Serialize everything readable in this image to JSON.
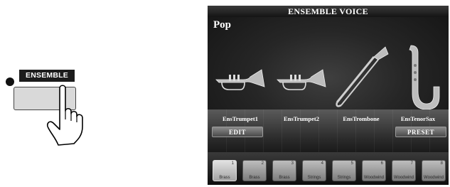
{
  "panel": {
    "button_label": "ENSEMBLE"
  },
  "screen": {
    "title": "ENSEMBLE VOICE",
    "category": "Pop",
    "instruments": [
      {
        "name": "EnsTrumpet1",
        "icon": "trumpet-icon"
      },
      {
        "name": "EnsTrumpet2",
        "icon": "trumpet-icon"
      },
      {
        "name": "EnsTrombone",
        "icon": "trombone-icon"
      },
      {
        "name": "EnsTenorSax",
        "icon": "saxophone-icon"
      }
    ],
    "edit_label": "EDIT",
    "preset_label": "PRESET",
    "tabs": [
      {
        "number": "1",
        "label": "Brass"
      },
      {
        "number": "2",
        "label": "Brass"
      },
      {
        "number": "3",
        "label": "Brass"
      },
      {
        "number": "4",
        "label": "Strings"
      },
      {
        "number": "5",
        "label": "Strings"
      },
      {
        "number": "6",
        "label": "Woodwind"
      },
      {
        "number": "7",
        "label": "Woodwind"
      },
      {
        "number": "8",
        "label": "Woodwind"
      }
    ],
    "active_tab": "1"
  },
  "colors": {
    "screen_background": "#0d0d0d",
    "button_face": "#d9d9d9",
    "label_background": "#1c1c1c"
  }
}
